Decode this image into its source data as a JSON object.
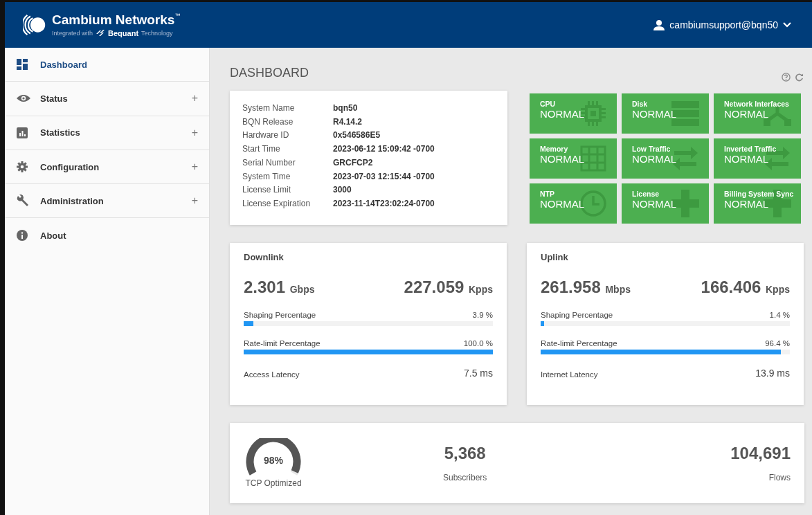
{
  "header": {
    "brand": "Cambium Networks",
    "trademark": "™",
    "tagline_prefix": "Integrated with",
    "partner": "Bequant",
    "tagline_suffix": "Technology",
    "user": "cambiumsupport@bqn50"
  },
  "sidebar": {
    "items": [
      {
        "label": "Dashboard",
        "kind": "dashboard",
        "selected": true
      },
      {
        "label": "Status",
        "kind": "eye",
        "selected": false,
        "toggle": "+"
      },
      {
        "label": "Statistics",
        "kind": "chart",
        "selected": false,
        "toggle": "+"
      },
      {
        "label": "Configuration",
        "kind": "gear",
        "selected": false,
        "toggle": "+"
      },
      {
        "label": "Administration",
        "kind": "wrench",
        "selected": false,
        "toggle": "+"
      },
      {
        "label": "About",
        "kind": "info",
        "selected": false
      }
    ]
  },
  "page": {
    "title": "DASHBOARD"
  },
  "system_info": [
    {
      "label": "System Name",
      "value": "bqn50"
    },
    {
      "label": "BQN Release",
      "value": "R4.14.2"
    },
    {
      "label": "Hardware ID",
      "value": "0x546586E5"
    },
    {
      "label": "Start Time",
      "value": "2023-06-12 15:09:42 -0700"
    },
    {
      "label": "Serial Number",
      "value": "GRCFCP2"
    },
    {
      "label": "System Time",
      "value": "2023-07-03 12:15:44 -0700"
    },
    {
      "label": "License Limit",
      "value": "3000"
    },
    {
      "label": "License Expiration",
      "value": "2023-11-14T23:02:24-0700"
    }
  ],
  "status_tiles": [
    {
      "title": "CPU",
      "status": "NORMAL",
      "kind": "chip"
    },
    {
      "title": "Disk",
      "status": "NORMAL",
      "kind": "stack"
    },
    {
      "title": "Network Interfaces",
      "status": "NORMAL",
      "kind": "tree"
    },
    {
      "title": "Memory",
      "status": "NORMAL",
      "kind": "grid"
    },
    {
      "title": "Low Traffic",
      "status": "NORMAL",
      "kind": "arrows"
    },
    {
      "title": "Inverted Traffic",
      "status": "NORMAL",
      "kind": "arrows"
    },
    {
      "title": "NTP",
      "status": "NORMAL",
      "kind": "clock"
    },
    {
      "title": "License",
      "status": "NORMAL",
      "kind": "cross"
    },
    {
      "title": "Billing System Sync",
      "status": "NORMAL",
      "kind": "cross"
    }
  ],
  "traffic": [
    {
      "title": "Downlink",
      "rate": "2.301",
      "rate_unit": "Gbps",
      "packets": "227.059",
      "packets_unit": "Kpps",
      "bars": [
        {
          "label": "Shaping Percentage",
          "reading": "3.9 %",
          "level": 0.039
        },
        {
          "label": "Rate-limit Percentage",
          "reading": "100.0 %",
          "level": 1.0
        }
      ],
      "latency_label": "Access Latency",
      "latency": "7.5 ms"
    },
    {
      "title": "Uplink",
      "rate": "261.958",
      "rate_unit": "Mbps",
      "packets": "166.406",
      "packets_unit": "Kpps",
      "bars": [
        {
          "label": "Shaping Percentage",
          "reading": "1.4 %",
          "level": 0.014
        },
        {
          "label": "Rate-limit Percentage",
          "reading": "96.4 %",
          "level": 0.964
        }
      ],
      "latency_label": "Internet Latency",
      "latency": "13.9 ms"
    }
  ],
  "summary": {
    "gauge": {
      "reading": "98%",
      "label": "TCP Optimized"
    },
    "subscribers": {
      "value": "5,368",
      "label": "Subscribers"
    },
    "flows": {
      "value": "104,691",
      "label": "Flows"
    }
  }
}
